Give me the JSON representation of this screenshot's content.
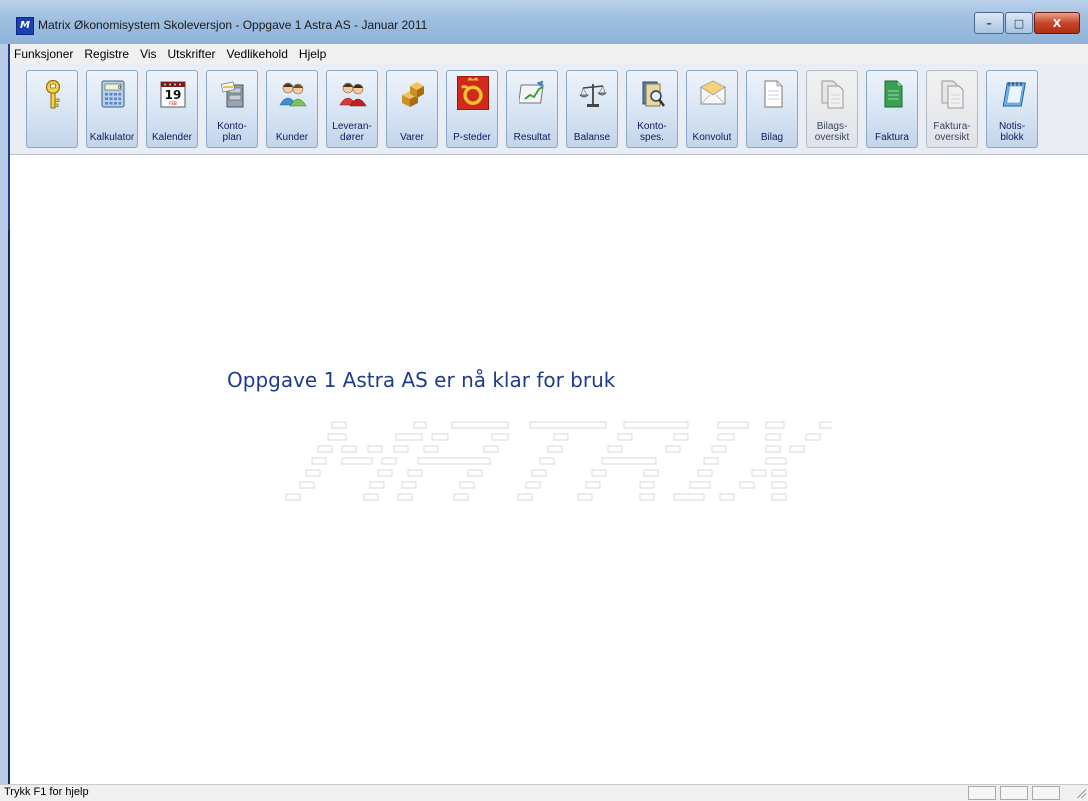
{
  "window": {
    "title": "Matrix Økonomisystem Skoleversjon - Oppgave 1 Astra AS - Januar 2011",
    "app_icon_text": "M",
    "controls": {
      "minimize": "–",
      "maximize": "□",
      "close": "X"
    }
  },
  "menu": [
    "Funksjoner",
    "Registre",
    "Vis",
    "Utskrifter",
    "Vedlikehold",
    "Hjelp"
  ],
  "toolbar": [
    {
      "label": "",
      "icon": "key-icon",
      "enabled": true
    },
    {
      "label": "Kalkulator",
      "icon": "calculator-icon",
      "enabled": true
    },
    {
      "label": "Kalender",
      "icon": "calendar-icon",
      "enabled": true,
      "icon_text": "19",
      "icon_subtext": "FEB"
    },
    {
      "label": "Konto-\nplan",
      "icon": "cabinet-icon",
      "enabled": true
    },
    {
      "label": "Kunder",
      "icon": "customers-icon",
      "enabled": true
    },
    {
      "label": "Leveran-\ndører",
      "icon": "suppliers-icon",
      "enabled": true
    },
    {
      "label": "Varer",
      "icon": "boxes-icon",
      "enabled": true
    },
    {
      "label": "P-steder",
      "icon": "posthorn-icon",
      "enabled": true
    },
    {
      "label": "Resultat",
      "icon": "result-icon",
      "enabled": true
    },
    {
      "label": "Balanse",
      "icon": "scales-icon",
      "enabled": true
    },
    {
      "label": "Konto-\nspes.",
      "icon": "ledger-search-icon",
      "enabled": true
    },
    {
      "label": "Konvolut",
      "icon": "envelope-icon",
      "enabled": true
    },
    {
      "label": "Bilag",
      "icon": "document-icon",
      "enabled": true
    },
    {
      "label": "Bilags-\noversikt",
      "icon": "documents-icon",
      "enabled": false
    },
    {
      "label": "Faktura",
      "icon": "invoice-icon",
      "enabled": true
    },
    {
      "label": "Faktura-\noversikt",
      "icon": "invoices-icon",
      "enabled": false
    },
    {
      "label": "Notis-\nblokk",
      "icon": "notepad-icon",
      "enabled": true
    }
  ],
  "main": {
    "message": "Oppgave 1 Astra AS er nå klar for bruk",
    "watermark_logo": "MATRIX"
  },
  "status": {
    "text": "Trykk F1 for hjelp"
  },
  "colors": {
    "title_gradient": "#b9d1ea",
    "message": "#1f3d8a",
    "toolbar_button": "#d7e4f3"
  }
}
